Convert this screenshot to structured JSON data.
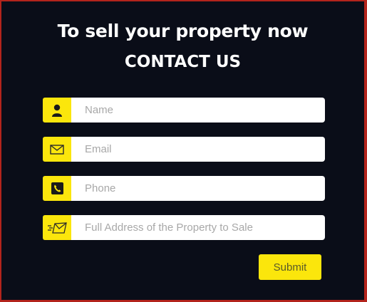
{
  "heading": {
    "title": "To sell your property now",
    "subtitle": "CONTACT US"
  },
  "form": {
    "fields": [
      {
        "icon": "user-icon",
        "placeholder": "Name",
        "value": ""
      },
      {
        "icon": "envelope-icon",
        "placeholder": "Email",
        "value": ""
      },
      {
        "icon": "phone-icon",
        "placeholder": "Phone",
        "value": ""
      },
      {
        "icon": "send-mail-icon",
        "placeholder": "Full Address of the Property to Sale",
        "value": ""
      }
    ],
    "submit_label": "Submit"
  },
  "colors": {
    "accent": "#fbe60c",
    "background": "#0a0d18",
    "border": "#b3241c"
  }
}
